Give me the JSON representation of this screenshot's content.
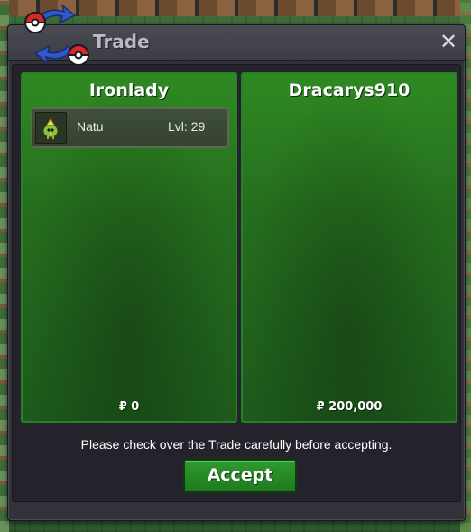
{
  "window": {
    "title": "Trade",
    "close_icon": "close-icon",
    "trade_icon": "trade-swap-pokeball-icon"
  },
  "trader_left": {
    "name": "Ironlady",
    "items": [
      {
        "sprite": "natu-sprite-icon",
        "name": "Natu",
        "level": "Lvl: 29"
      }
    ],
    "money": "₽ 0"
  },
  "trader_right": {
    "name": "Dracarys910",
    "items": [],
    "money": "₽ 200,000"
  },
  "notice": "Please check over the Trade carefully before accepting.",
  "accept_label": "Accept",
  "colors": {
    "panel_green": "#256d1e",
    "panel_border": "#2a7f2a",
    "accept_green": "#1f7a1f",
    "window_bg": "#33323b"
  }
}
